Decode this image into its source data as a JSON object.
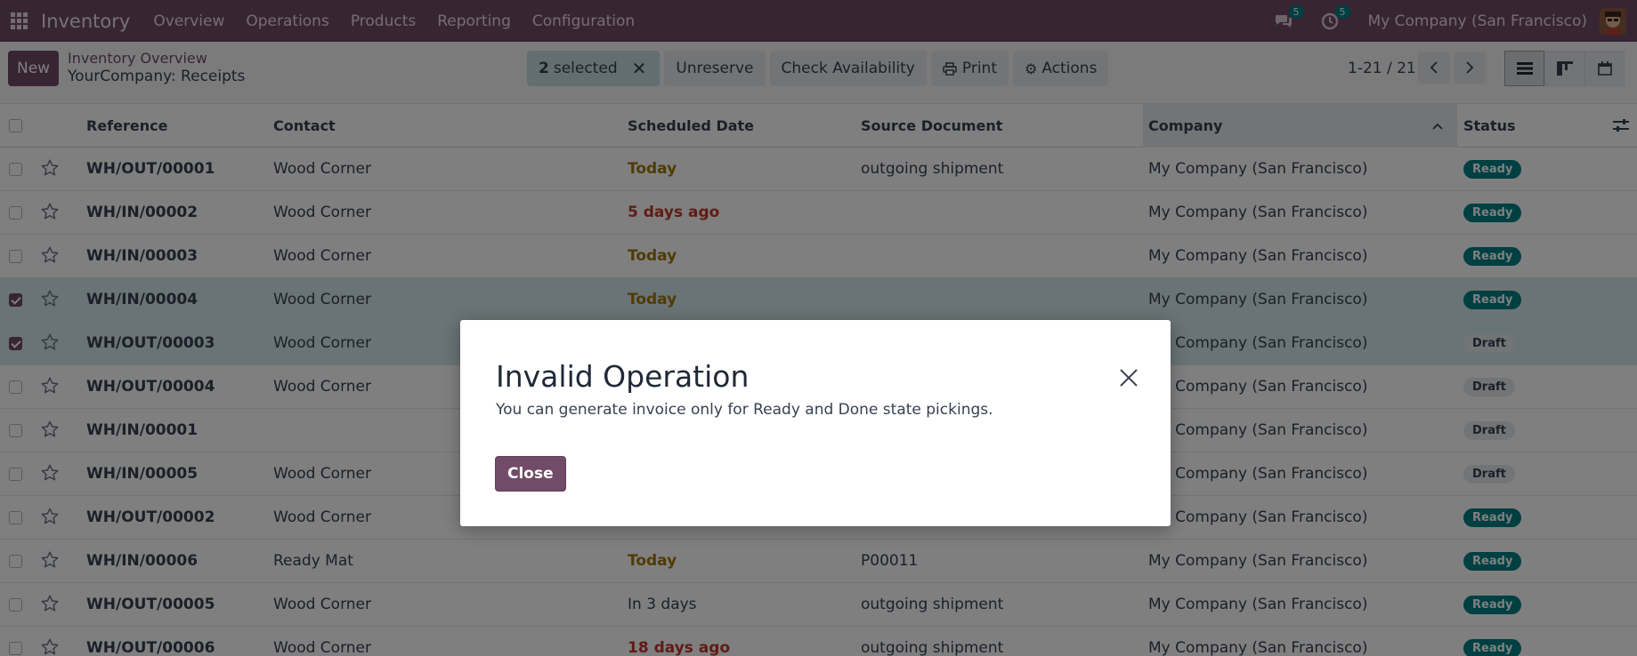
{
  "navbar": {
    "brand": "Inventory",
    "menu": [
      "Overview",
      "Operations",
      "Products",
      "Reporting",
      "Configuration"
    ],
    "messages_count": "5",
    "activities_count": "5",
    "company": "My Company (San Francisco)"
  },
  "control_panel": {
    "new_label": "New",
    "breadcrumb_parent": "Inventory Overview",
    "breadcrumb_current": "YourCompany: Receipts",
    "selected_count": "2",
    "selected_label": "selected",
    "unreserve_label": "Unreserve",
    "check_availability_label": "Check Availability",
    "print_label": "Print",
    "actions_label": "Actions",
    "pager": "1-21 / 21"
  },
  "table": {
    "headers": {
      "reference": "Reference",
      "contact": "Contact",
      "scheduled_date": "Scheduled Date",
      "source_document": "Source Document",
      "company": "Company",
      "status": "Status"
    },
    "rows": [
      {
        "reference": "WH/OUT/00001",
        "contact": "Wood Corner",
        "date": "Today",
        "source": "outgoing shipment",
        "company": "My Company (San Francisco)",
        "status": "Ready"
      },
      {
        "reference": "WH/IN/00002",
        "contact": "Wood Corner",
        "date": "5 days ago",
        "source": "",
        "company": "My Company (San Francisco)",
        "status": "Ready"
      },
      {
        "reference": "WH/IN/00003",
        "contact": "Wood Corner",
        "date": "Today",
        "source": "",
        "company": "My Company (San Francisco)",
        "status": "Ready"
      },
      {
        "reference": "WH/IN/00004",
        "contact": "Wood Corner",
        "date": "Today",
        "source": "",
        "company": "My Company (San Francisco)",
        "status": "Ready"
      },
      {
        "reference": "WH/OUT/00003",
        "contact": "Wood Corner",
        "date": "",
        "source": "",
        "company": "My Company (San Francisco)",
        "status": "Draft"
      },
      {
        "reference": "WH/OUT/00004",
        "contact": "Wood Corner",
        "date": "",
        "source": "",
        "company": "My Company (San Francisco)",
        "status": "Draft"
      },
      {
        "reference": "WH/IN/00001",
        "contact": "",
        "date": "",
        "source": "",
        "company": "My Company (San Francisco)",
        "status": "Draft"
      },
      {
        "reference": "WH/IN/00005",
        "contact": "Wood Corner",
        "date": "",
        "source": "",
        "company": "My Company (San Francisco)",
        "status": "Draft"
      },
      {
        "reference": "WH/OUT/00002",
        "contact": "Wood Corner",
        "date": "",
        "source": "",
        "company": "My Company (San Francisco)",
        "status": "Ready"
      },
      {
        "reference": "WH/IN/00006",
        "contact": "Ready Mat",
        "date": "Today",
        "source": "P00011",
        "company": "My Company (San Francisco)",
        "status": "Ready"
      },
      {
        "reference": "WH/OUT/00005",
        "contact": "Wood Corner",
        "date": "In 3 days",
        "source": "outgoing shipment",
        "company": "My Company (San Francisco)",
        "status": "Ready"
      },
      {
        "reference": "WH/OUT/00006",
        "contact": "Wood Corner",
        "date": "18 days ago",
        "source": "outgoing shipment",
        "company": "My Company (San Francisco)",
        "status": "Ready"
      }
    ]
  },
  "dialog": {
    "title": "Invalid Operation",
    "message": "You can generate invoice only for Ready and Done state pickings.",
    "close_label": "Close"
  },
  "colors": {
    "brand": "#714b67",
    "ready": "#017e84",
    "today": "#a0770a",
    "late": "#c0392b"
  }
}
